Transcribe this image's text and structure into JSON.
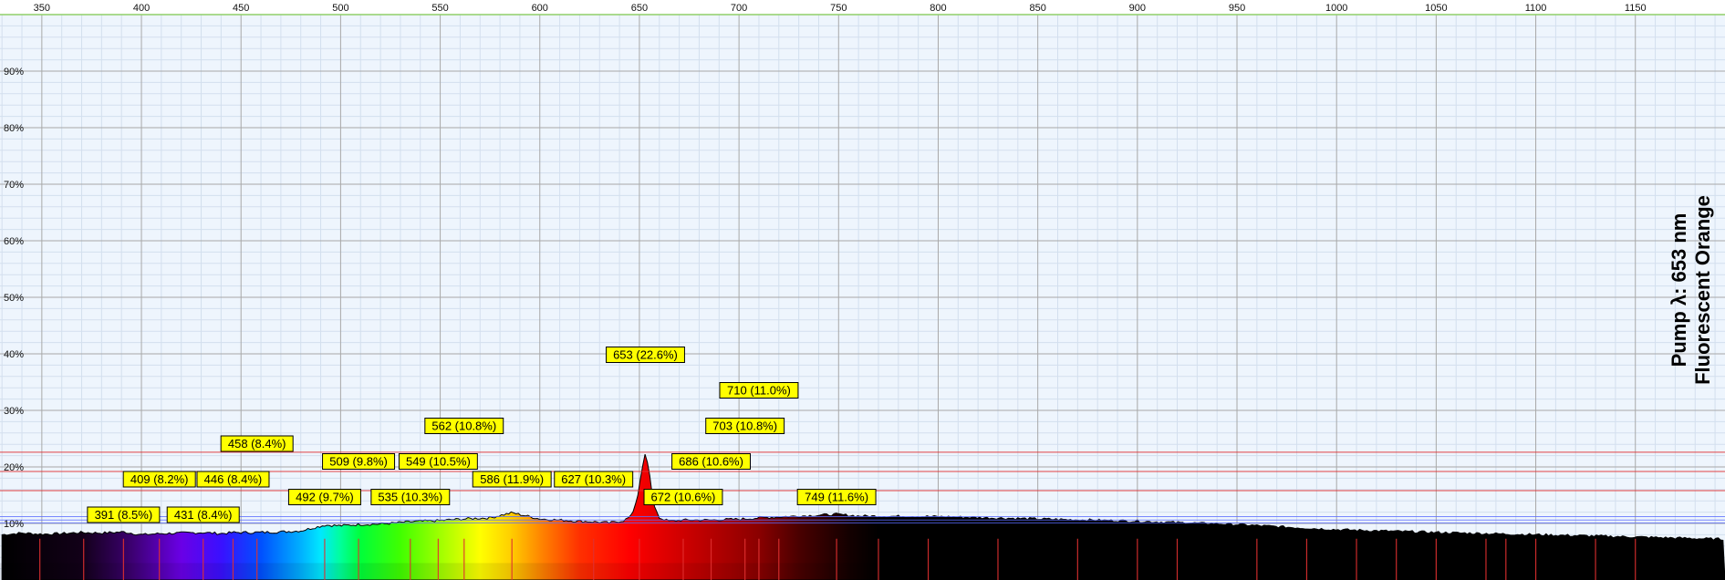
{
  "chart_data": {
    "type": "line",
    "title_lines": [
      "Pump λ: 653 nm",
      "Fluorescent Orange"
    ],
    "xlabel": "",
    "ylabel": "",
    "xlim": [
      329,
      1195
    ],
    "ylim": [
      0,
      100
    ],
    "x_ticks": [
      350,
      400,
      450,
      500,
      550,
      600,
      650,
      700,
      750,
      800,
      850,
      900,
      950,
      1000,
      1050,
      1100,
      1150
    ],
    "y_ticks": [
      10,
      20,
      30,
      40,
      50,
      60,
      70,
      80,
      90
    ],
    "y_tick_labels": [
      "10%",
      "20%",
      "30%",
      "40%",
      "50%",
      "60%",
      "70%",
      "80%",
      "90%"
    ],
    "grid": true,
    "reference_lines_y": [
      22.6,
      19.2,
      15.8,
      11.2,
      10.6,
      10.1
    ],
    "spectrum": {
      "x": [
        330,
        340,
        350,
        360,
        370,
        380,
        391,
        400,
        409,
        420,
        431,
        440,
        446,
        458,
        470,
        480,
        492,
        500,
        509,
        520,
        535,
        549,
        562,
        575,
        586,
        600,
        615,
        627,
        635,
        642,
        646,
        649,
        651,
        653,
        655,
        657,
        660,
        665,
        672,
        686,
        703,
        710,
        730,
        749,
        760,
        800,
        850,
        900,
        950,
        1000,
        1050,
        1100,
        1150,
        1195
      ],
      "y": [
        8.0,
        8.3,
        8.1,
        8.2,
        8.4,
        8.3,
        8.5,
        8.0,
        8.2,
        8.3,
        8.4,
        8.2,
        8.4,
        8.4,
        8.5,
        8.7,
        9.7,
        9.6,
        9.8,
        9.9,
        10.3,
        10.5,
        10.8,
        11.0,
        11.9,
        10.8,
        10.5,
        10.3,
        10.1,
        10.5,
        11.3,
        14.5,
        19.0,
        22.6,
        19.0,
        13.5,
        11.0,
        10.4,
        10.6,
        10.6,
        10.8,
        11.0,
        11.3,
        11.6,
        11.3,
        11.2,
        10.8,
        10.4,
        9.8,
        8.9,
        8.4,
        8.0,
        7.6,
        7.2
      ]
    },
    "peaks": [
      {
        "x": 391,
        "y": 8.5,
        "label": "391 (8.5%)"
      },
      {
        "x": 409,
        "y": 8.2,
        "label": "409 (8.2%)"
      },
      {
        "x": 431,
        "y": 8.4,
        "label": "431 (8.4%)"
      },
      {
        "x": 446,
        "y": 8.4,
        "label": "446 (8.4%)"
      },
      {
        "x": 458,
        "y": 8.4,
        "label": "458 (8.4%)"
      },
      {
        "x": 492,
        "y": 9.7,
        "label": "492 (9.7%)"
      },
      {
        "x": 509,
        "y": 9.8,
        "label": "509 (9.8%)"
      },
      {
        "x": 535,
        "y": 10.3,
        "label": "535 (10.3%)"
      },
      {
        "x": 549,
        "y": 10.5,
        "label": "549 (10.5%)"
      },
      {
        "x": 562,
        "y": 10.8,
        "label": "562 (10.8%)"
      },
      {
        "x": 586,
        "y": 11.9,
        "label": "586 (11.9%)"
      },
      {
        "x": 627,
        "y": 10.3,
        "label": "627 (10.3%)"
      },
      {
        "x": 653,
        "y": 22.6,
        "label": "653 (22.6%)"
      },
      {
        "x": 672,
        "y": 10.6,
        "label": "672 (10.6%)"
      },
      {
        "x": 686,
        "y": 10.6,
        "label": "686 (10.6%)"
      },
      {
        "x": 703,
        "y": 10.8,
        "label": "703 (10.8%)"
      },
      {
        "x": 710,
        "y": 11.0,
        "label": "710 (11.0%)"
      },
      {
        "x": 749,
        "y": 11.6,
        "label": "749 (11.6%)"
      }
    ],
    "marker_lines_x": [
      349,
      371,
      391,
      409,
      431,
      446,
      458,
      492,
      509,
      535,
      549,
      562,
      586,
      627,
      650,
      672,
      686,
      703,
      710,
      720,
      749,
      770,
      795,
      830,
      870,
      900,
      920,
      960,
      985,
      1010,
      1030,
      1050,
      1075,
      1085,
      1100,
      1130,
      1150
    ],
    "colors": {
      "plot_background": "#eef5fd",
      "grid_major": "#a8a8a8",
      "grid_minor": "#d3dfee",
      "reference_line": "#e03030",
      "marker_line": "#e03030",
      "top_axis_line": "#8fcf6a",
      "spectrum_outline": "#000000",
      "label_fill": "#ffff00",
      "label_border": "#000000"
    }
  }
}
